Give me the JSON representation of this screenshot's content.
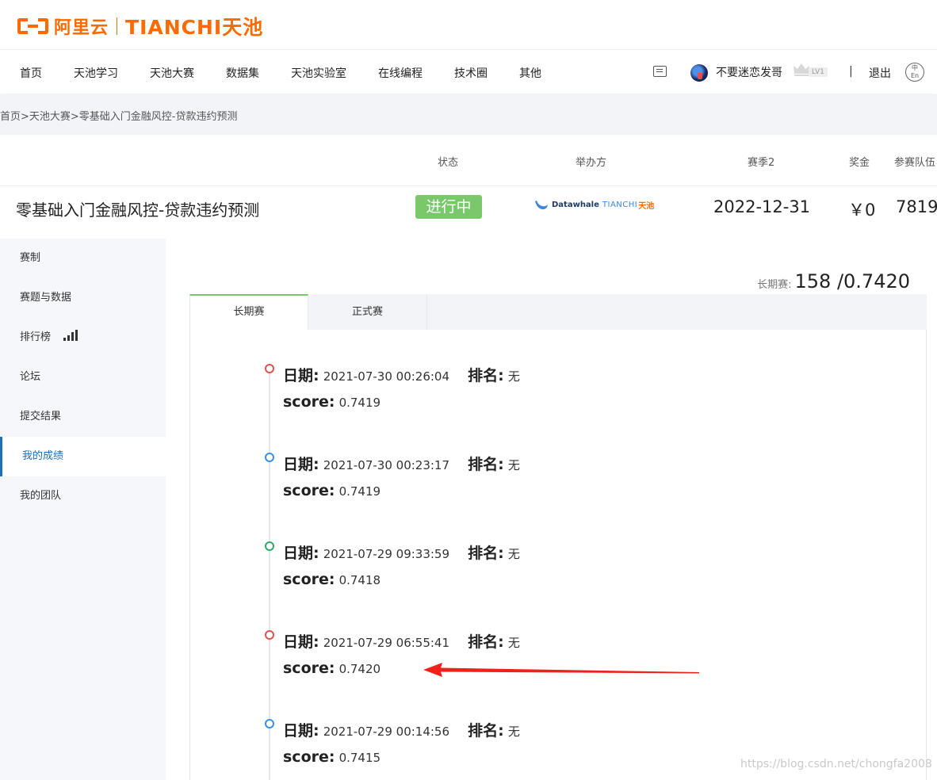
{
  "brand": {
    "aliyun": "阿里云",
    "tianchi": "TIANCHI天池"
  },
  "nav": {
    "items": [
      "首页",
      "天池学习",
      "天池大赛",
      "数据集",
      "天池实验室",
      "在线编程",
      "技术圈",
      "其他"
    ],
    "username": "不要迷恋发哥",
    "level": "LV1",
    "separator": "|",
    "logout": "退出",
    "lang_top": "中",
    "lang_bottom": "En"
  },
  "breadcrumb": "首页>天池大赛>零基础入门金融风控-贷款违约预测",
  "info": {
    "headers": {
      "status": "状态",
      "organizer": "举办方",
      "season": "赛季2",
      "prize": "奖金",
      "teams": "参赛队伍"
    },
    "title": "零基础入门金融风控-贷款违约预测",
    "status": "进行中",
    "organizer_a": "Datawhale",
    "organizer_b": "TIANCHI",
    "organizer_c": "天池",
    "season_end": "2022-12-31",
    "prize": "￥0",
    "teams": "7819"
  },
  "sidebar": {
    "items": [
      {
        "label": "赛制"
      },
      {
        "label": "赛题与数据"
      },
      {
        "label": "排行榜"
      },
      {
        "label": "论坛"
      },
      {
        "label": "提交结果"
      },
      {
        "label": "我的成绩"
      },
      {
        "label": "我的团队"
      }
    ]
  },
  "main": {
    "rank_label": "长期赛:",
    "rank_value": "158 /0.7420",
    "tabs": [
      "长期赛",
      "正式赛"
    ],
    "date_label": "日期:",
    "rank_item_label": "排名:",
    "score_label": "score:",
    "entries": [
      {
        "date": "2021-07-30 00:26:04",
        "rank": "无",
        "score": "0.7419",
        "color": "#e0524f"
      },
      {
        "date": "2021-07-30 00:23:17",
        "rank": "无",
        "score": "0.7419",
        "color": "#3b8fd9"
      },
      {
        "date": "2021-07-29 09:33:59",
        "rank": "无",
        "score": "0.7418",
        "color": "#2ea86a"
      },
      {
        "date": "2021-07-29 06:55:41",
        "rank": "无",
        "score": "0.7420",
        "color": "#e0524f"
      },
      {
        "date": "2021-07-29 00:14:56",
        "rank": "无",
        "score": "0.7415",
        "color": "#3b8fd9"
      }
    ]
  },
  "colors": {
    "brand_orange": "#ff6a00",
    "status_green": "#7ac86c",
    "active_blue": "#1d6fb8",
    "annotation_red": "#f2201a"
  },
  "watermark": "https://blog.csdn.net/chongfa2008"
}
